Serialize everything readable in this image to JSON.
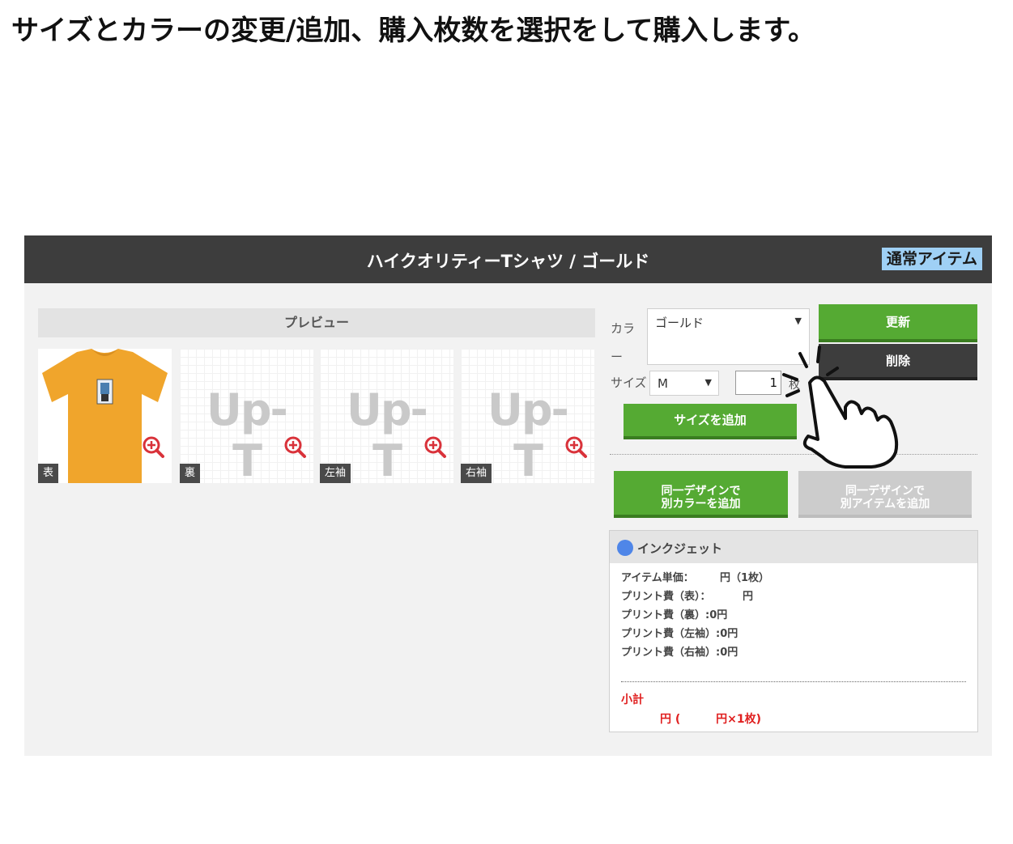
{
  "instruction": "サイズとカラーの変更/追加、購入枚数を選択をして購入します。",
  "header": {
    "product_title": "ハイクオリティーTシャツ / ゴールド",
    "item_badge": "通常アイテム"
  },
  "preview": {
    "title": "プレビュー",
    "thumbnails": [
      {
        "label": "表",
        "placeholder": ""
      },
      {
        "label": "裏",
        "placeholder": "Up-T"
      },
      {
        "label": "左袖",
        "placeholder": "Up-T"
      },
      {
        "label": "右袖",
        "placeholder": "Up-T"
      }
    ]
  },
  "options": {
    "color_label": "カラー",
    "color_value": "ゴールド",
    "size_label": "サイズ",
    "size_value": "M",
    "quantity_value": "1",
    "quantity_unit": "枚",
    "update_label": "更新",
    "delete_label": "削除",
    "add_size_label": "サイズを追加",
    "add_color_label_1": "同一デザインで",
    "add_color_label_2": "別カラーを追加",
    "add_item_label_1": "同一デザインで",
    "add_item_label_2": "別アイテムを追加"
  },
  "summary": {
    "method": "インクジェット",
    "rows": [
      {
        "key": "アイテム単価：",
        "value": "円（1枚）"
      },
      {
        "key": "プリント費（表）：",
        "value": "円"
      },
      {
        "key": "プリント費（裏）",
        "value": ":0円"
      },
      {
        "key": "プリント費（左袖）",
        "value": ":0円"
      },
      {
        "key": "プリント費（右袖）",
        "value": ":0円"
      }
    ],
    "subtotal_label": "小計",
    "subtotal_value": "円 (         円×1枚)"
  },
  "colors": {
    "header_bg": "#3d3d3d",
    "badge_bg": "#9fd0f5",
    "green": "#55aa33",
    "dark": "#3d3d3d",
    "disabled": "#cccccc",
    "accent_red": "#e02020",
    "dot_blue": "#4f86e8",
    "shirt": "#f0a52c"
  }
}
